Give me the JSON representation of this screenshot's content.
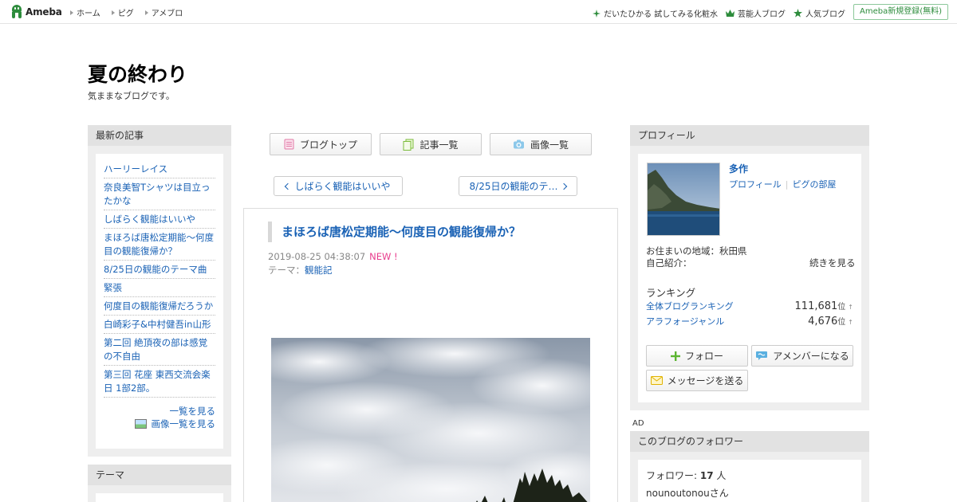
{
  "header": {
    "logo_text": "Ameba",
    "nav": [
      "ホーム",
      "ピグ",
      "アメブロ"
    ],
    "links": [
      {
        "label": "だいたひかる 試してみる化粧水",
        "icon": "sparkle-icon"
      },
      {
        "label": "芸能人ブログ",
        "icon": "crown-icon"
      },
      {
        "label": "人気ブログ",
        "icon": "star-icon"
      }
    ],
    "register_label": "Ameba新規登録(無料)"
  },
  "blog": {
    "title": "夏の終わり",
    "description": "気ままなブログです。"
  },
  "recent": {
    "heading": "最新の記事",
    "items": [
      "ハーリーレイス",
      "奈良美智Tシャツは目立ったかな",
      "しばらく観能はいいや",
      "まほろば唐松定期能〜何度目の観能復帰か？",
      "8/25日の観能のテーマ曲",
      "緊張",
      "何度目の観能復帰だろうか",
      "白崎彩子&中村健吾in山形",
      "第二回 絶頂夜の部は感覚の不自由",
      "第三回 花座 東西交流会楽日 1部2部。"
    ],
    "see_all": "一覧を見る",
    "see_images": "画像一覧を見る"
  },
  "theme_box": {
    "heading": "テーマ"
  },
  "center_nav": {
    "blog_top": "ブログトップ",
    "article_list": "記事一覧",
    "image_list": "画像一覧"
  },
  "pager": {
    "prev": "しばらく観能はいいや",
    "next": "8/25日の観能のテ…"
  },
  "article": {
    "title": "まほろば唐松定期能〜何度目の観能復帰か？",
    "date": "2019-08-25 04:38:07",
    "new_badge": "NEW !",
    "theme_prefix": "テーマ：",
    "theme": "観能記"
  },
  "profile": {
    "heading": "プロフィール",
    "name": "多作",
    "profile_link": "プロフィール",
    "pigg_link": "ピグの部屋",
    "residence": "お住まいの地域：秋田県",
    "intro_label": "自己紹介：",
    "continue_link": "続きを見る",
    "ranking_heading": "ランキング",
    "rankings": [
      {
        "label": "全体ブログランキング",
        "value": "111,681",
        "unit": "位",
        "arrow": "↑"
      },
      {
        "label": "アラフォージャンル",
        "value": "4,676",
        "unit": "位",
        "arrow": "↑"
      }
    ],
    "follow_label": "フォロー",
    "amember_label": "アメンバーになる",
    "message_label": "メッセージを送る"
  },
  "ad_label": "AD",
  "followers": {
    "heading": "このブログのフォロワー",
    "count_label": "フォロワー: ",
    "count": "17",
    "count_unit": " 人",
    "first": "nounoutonouさん"
  },
  "colors": {
    "link": "#1a62b5",
    "new_badge": "#e83c8c",
    "brand_green": "#2d8c3c"
  }
}
